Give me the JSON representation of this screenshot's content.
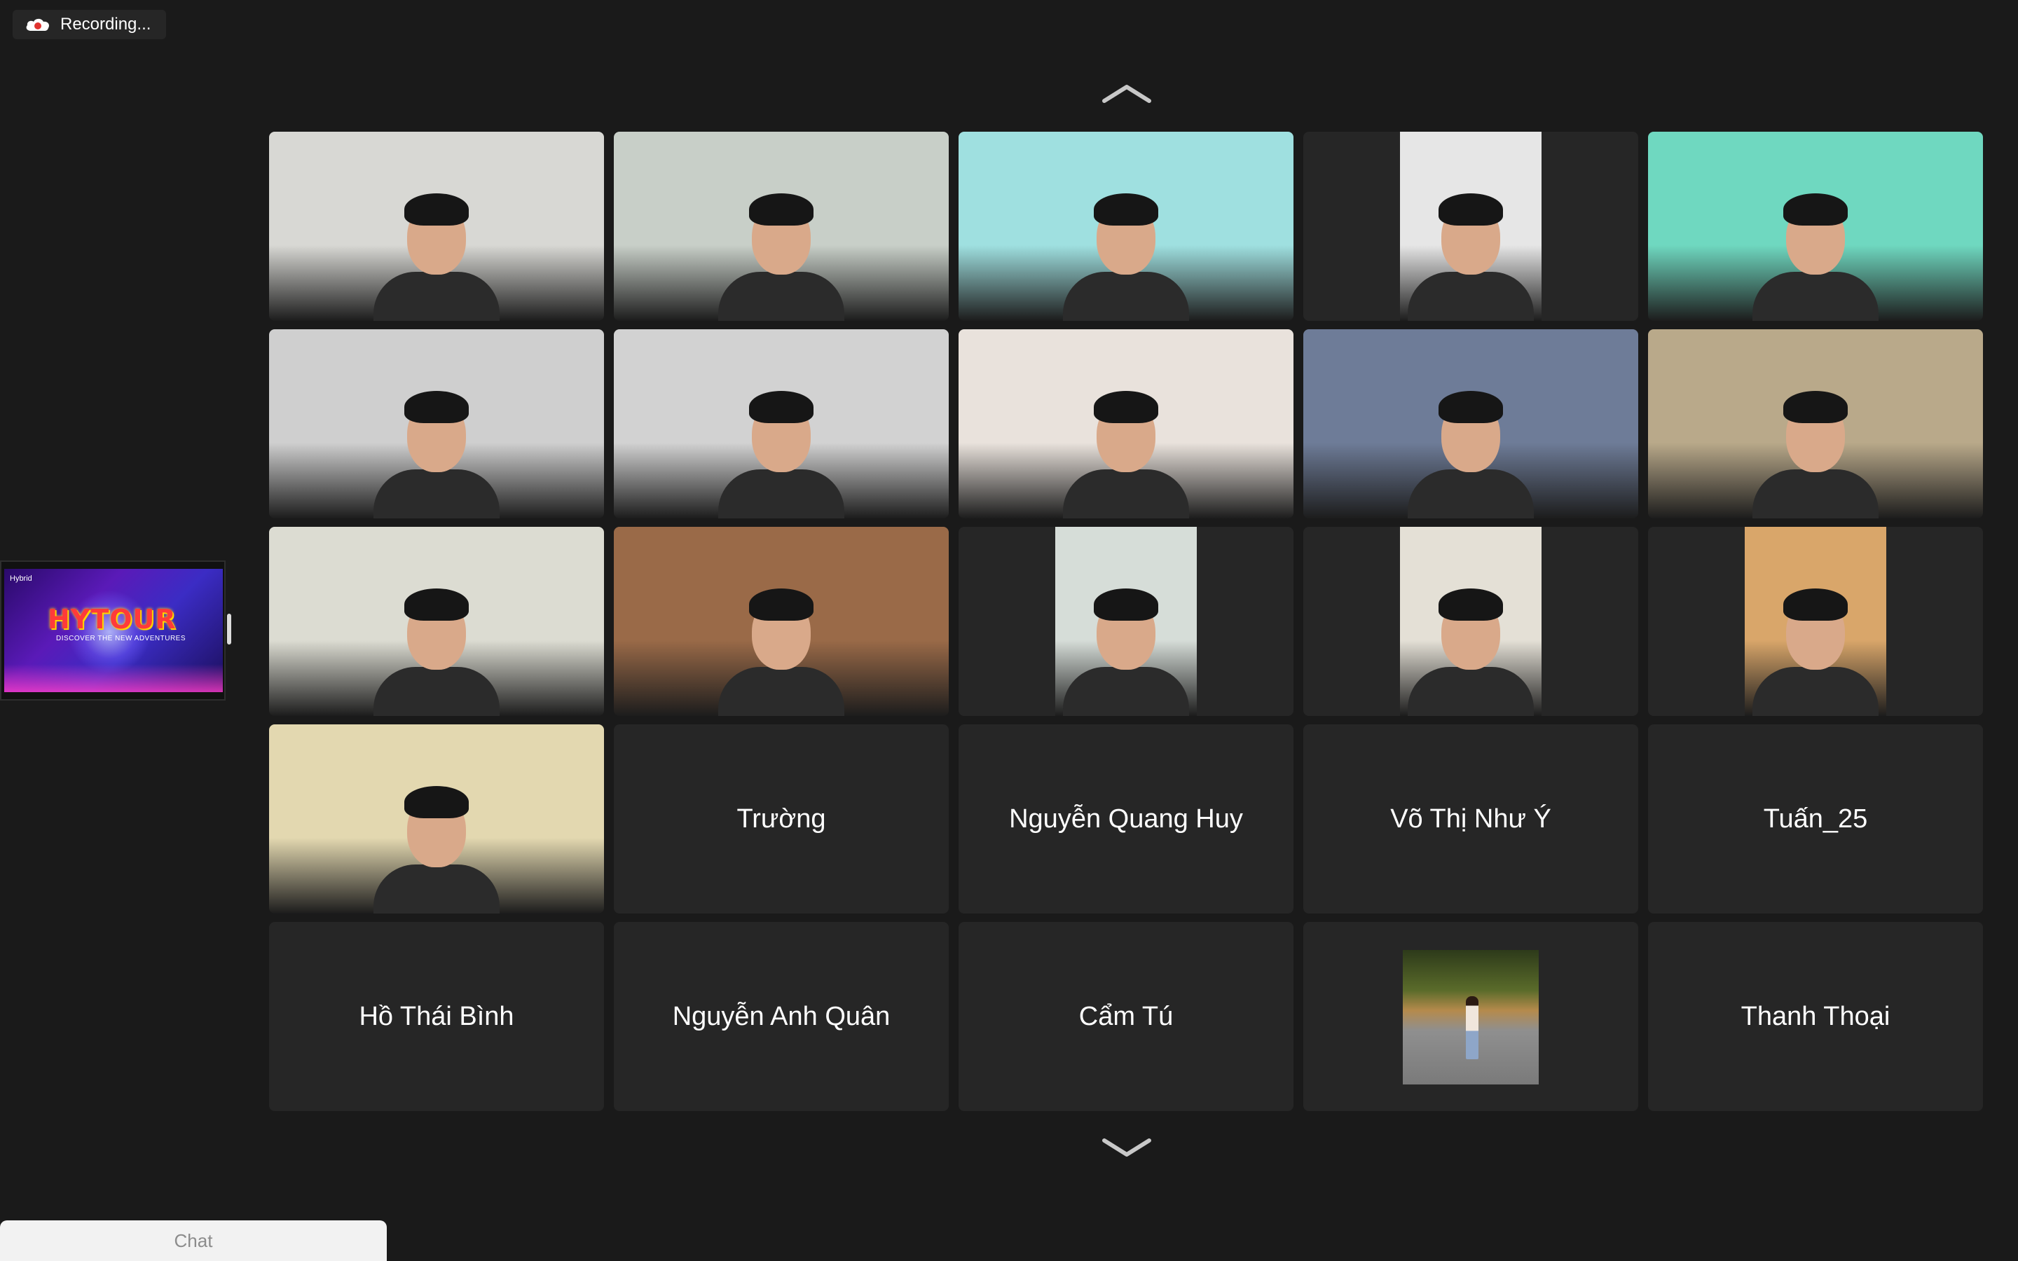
{
  "recording": {
    "label": "Recording..."
  },
  "shared_screen": {
    "brand": "Hybrid",
    "title": "HYTOUR",
    "subtitle": "DISCOVER THE NEW ADVENTURES"
  },
  "participants": [
    {
      "type": "video",
      "bg": "#d8d8d4"
    },
    {
      "type": "video",
      "bg": "#c8cfc8"
    },
    {
      "type": "video",
      "bg": "#9fe0e0"
    },
    {
      "type": "video-narrow",
      "bg": "#e6e6e6"
    },
    {
      "type": "video",
      "bg": "#6fd8c0"
    },
    {
      "type": "video",
      "bg": "#cfcfcf"
    },
    {
      "type": "video",
      "bg": "#d2d2d2"
    },
    {
      "type": "video",
      "bg": "#e9e2dc"
    },
    {
      "type": "video",
      "bg": "#6e7c98"
    },
    {
      "type": "video",
      "bg": "#b9a98a"
    },
    {
      "type": "video",
      "bg": "#dcdcd2"
    },
    {
      "type": "video",
      "bg": "#9a6a48"
    },
    {
      "type": "video-narrow",
      "bg": "#d6ddd8"
    },
    {
      "type": "video-narrow",
      "bg": "#e4e0d6"
    },
    {
      "type": "video-narrow",
      "bg": "#d9a66a"
    },
    {
      "type": "video",
      "bg": "#e3d8b0"
    },
    {
      "type": "name",
      "name": "Trường"
    },
    {
      "type": "name",
      "name": "Nguyễn Quang Huy"
    },
    {
      "type": "name",
      "name": "Võ Thị Như Ý"
    },
    {
      "type": "name",
      "name": "Tuấn_25"
    },
    {
      "type": "name",
      "name": "Hồ Thái Bình"
    },
    {
      "type": "name",
      "name": "Nguyễn Anh Quân"
    },
    {
      "type": "name",
      "name": "Cẩm Tú"
    },
    {
      "type": "avatar"
    },
    {
      "type": "name",
      "name": "Thanh Thoại"
    }
  ],
  "chat": {
    "label": "Chat"
  },
  "icons": {
    "record": "cloud-record-icon",
    "page_up": "chevron-up-icon",
    "page_down": "chevron-down-icon"
  },
  "colors": {
    "background": "#1a1a1a",
    "tile": "#262626",
    "text": "#ffffff"
  }
}
